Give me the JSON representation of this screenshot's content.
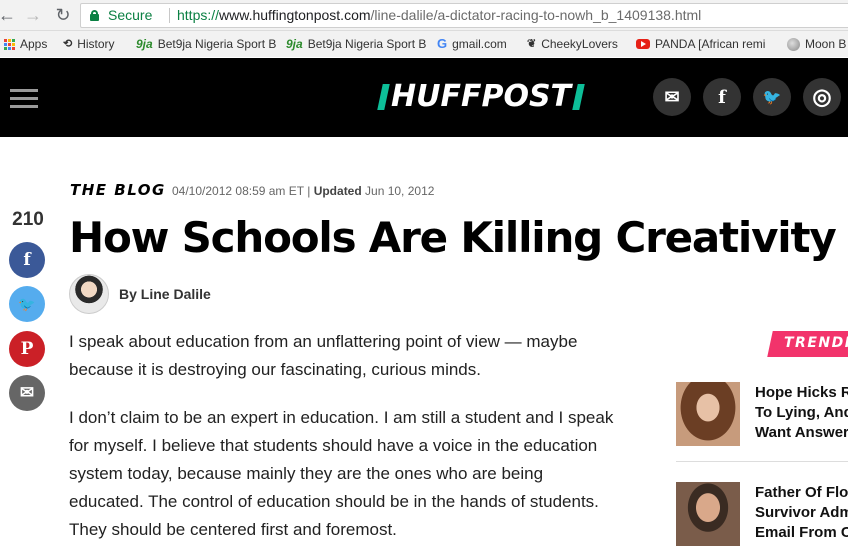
{
  "browser": {
    "secure_label": "Secure",
    "url_scheme": "https://",
    "url_host": "www.huffingtonpost.com",
    "url_path": "/line-dalile/a-dictator-racing-to-nowh_b_1409138.html",
    "bookmarks": [
      {
        "label": "Apps",
        "icon": "apps-grid-icon"
      },
      {
        "label": "History",
        "icon": "history-icon"
      },
      {
        "label": "Bet9ja Nigeria Sport B",
        "icon": "bet9ja-icon"
      },
      {
        "label": "Bet9ja Nigeria Sport B",
        "icon": "bet9ja-icon"
      },
      {
        "label": "gmail.com",
        "icon": "google-icon"
      },
      {
        "label": "CheekyLovers",
        "icon": "cheekylovers-icon"
      },
      {
        "label": "PANDA [African remi",
        "icon": "youtube-icon"
      },
      {
        "label": "Moon B",
        "icon": "moon-icon"
      }
    ]
  },
  "site": {
    "logo": "HUFFPOST",
    "brand_color": "#0dbe98",
    "social": [
      {
        "name": "email",
        "glyph": "✉"
      },
      {
        "name": "facebook",
        "glyph": "f"
      },
      {
        "name": "twitter",
        "glyph": "🐦"
      },
      {
        "name": "instagram",
        "glyph": "◎"
      }
    ]
  },
  "article": {
    "kicker": "THE BLOG",
    "published": "04/10/2012 08:59 am ET",
    "updated_label": "Updated",
    "updated": "Jun 10, 2012",
    "share_count": "210",
    "headline": "How Schools Are Killing Creativity",
    "byline": "By Line Dalile",
    "paragraphs": [
      [
        "I speak about education from an unflattering point of view — maybe",
        "because it is destroying our fascinating, curious minds."
      ],
      [
        "I don’t claim to be an expert in education. I am still a student and I speak",
        "for myself. I believe that students should have a voice in the education",
        "system today, because mainly they are the ones who are being",
        "educated. The control of education should be in the hands of students.",
        "They should be centered first and foremost."
      ]
    ]
  },
  "share_buttons": [
    {
      "name": "facebook",
      "glyph": "f",
      "color": "#3b5998"
    },
    {
      "name": "twitter",
      "glyph": "🐦",
      "color": "#55acee"
    },
    {
      "name": "pinterest",
      "glyph": "P",
      "color": "#cb2027"
    },
    {
      "name": "email",
      "glyph": "✉",
      "color": "#666666"
    }
  ],
  "trending": {
    "label": "TRENDING",
    "accent": "#f2336b",
    "items": [
      {
        "lines": [
          "Hope Hicks R",
          "To Lying, And",
          "Want Answer"
        ]
      },
      {
        "lines": [
          "Father Of Flor",
          "Survivor Adm",
          "Email From C"
        ]
      }
    ]
  }
}
